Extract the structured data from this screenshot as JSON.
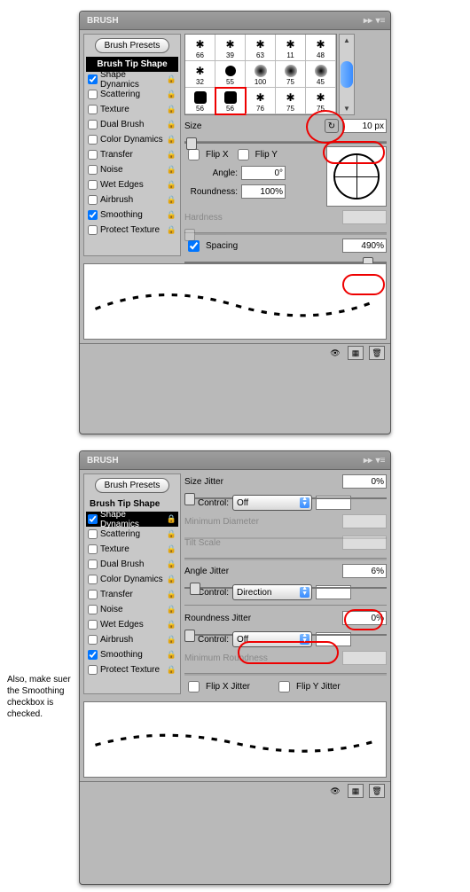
{
  "panel1": {
    "title": "BRUSH",
    "presets_label": "Brush Presets",
    "sidebar_header": "Brush Tip Shape",
    "items": [
      {
        "label": "Shape Dynamics",
        "checked": true
      },
      {
        "label": "Scattering",
        "checked": false
      },
      {
        "label": "Texture",
        "checked": false
      },
      {
        "label": "Dual Brush",
        "checked": false
      },
      {
        "label": "Color Dynamics",
        "checked": false
      },
      {
        "label": "Transfer",
        "checked": false
      },
      {
        "label": "Noise",
        "checked": false
      },
      {
        "label": "Wet Edges",
        "checked": false
      },
      {
        "label": "Airbrush",
        "checked": false
      },
      {
        "label": "Smoothing",
        "checked": true
      },
      {
        "label": "Protect Texture",
        "checked": false
      }
    ],
    "brushes": [
      {
        "v": "66",
        "t": "splat"
      },
      {
        "v": "39",
        "t": "splat"
      },
      {
        "v": "63",
        "t": "splat"
      },
      {
        "v": "11",
        "t": "splat"
      },
      {
        "v": "48",
        "t": "splat"
      },
      {
        "v": "32",
        "t": "splat"
      },
      {
        "v": "55",
        "t": "dot"
      },
      {
        "v": "100",
        "t": "fuzzy"
      },
      {
        "v": "75",
        "t": "fuzzy"
      },
      {
        "v": "45",
        "t": "fuzzy"
      },
      {
        "v": "56",
        "t": "sq"
      },
      {
        "v": "56",
        "t": "sq",
        "sel": true
      },
      {
        "v": "76",
        "t": "splat"
      },
      {
        "v": "75",
        "t": "splat"
      },
      {
        "v": "75",
        "t": "splat"
      }
    ],
    "size_label": "Size",
    "size_value": "10 px",
    "flipx_label": "Flip X",
    "flipy_label": "Flip Y",
    "angle_label": "Angle:",
    "angle_value": "0°",
    "roundness_label": "Roundness:",
    "roundness_value": "100%",
    "hardness_label": "Hardness",
    "spacing_label": "Spacing",
    "spacing_value": "490%"
  },
  "panel2": {
    "title": "BRUSH",
    "presets_label": "Brush Presets",
    "sidebar_plain": "Brush Tip Shape",
    "items": [
      {
        "label": "Shape Dynamics",
        "checked": true,
        "selected": true
      },
      {
        "label": "Scattering",
        "checked": false
      },
      {
        "label": "Texture",
        "checked": false
      },
      {
        "label": "Dual Brush",
        "checked": false
      },
      {
        "label": "Color Dynamics",
        "checked": false
      },
      {
        "label": "Transfer",
        "checked": false
      },
      {
        "label": "Noise",
        "checked": false
      },
      {
        "label": "Wet Edges",
        "checked": false
      },
      {
        "label": "Airbrush",
        "checked": false
      },
      {
        "label": "Smoothing",
        "checked": true
      },
      {
        "label": "Protect Texture",
        "checked": false
      }
    ],
    "size_jitter_label": "Size Jitter",
    "size_jitter_value": "0%",
    "control_label": "Control:",
    "size_control": "Off",
    "min_diam_label": "Minimum Diameter",
    "tilt_label": "Tilt Scale",
    "angle_jitter_label": "Angle Jitter",
    "angle_jitter_value": "6%",
    "angle_control": "Direction",
    "roundness_jitter_label": "Roundness Jitter",
    "roundness_jitter_value": "0%",
    "roundness_control": "Off",
    "min_round_label": "Minimum Roundness",
    "flipx_jitter": "Flip X Jitter",
    "flipy_jitter": "Flip Y Jitter"
  },
  "note": "Also, make suer the Smoothing checkbox is checked."
}
